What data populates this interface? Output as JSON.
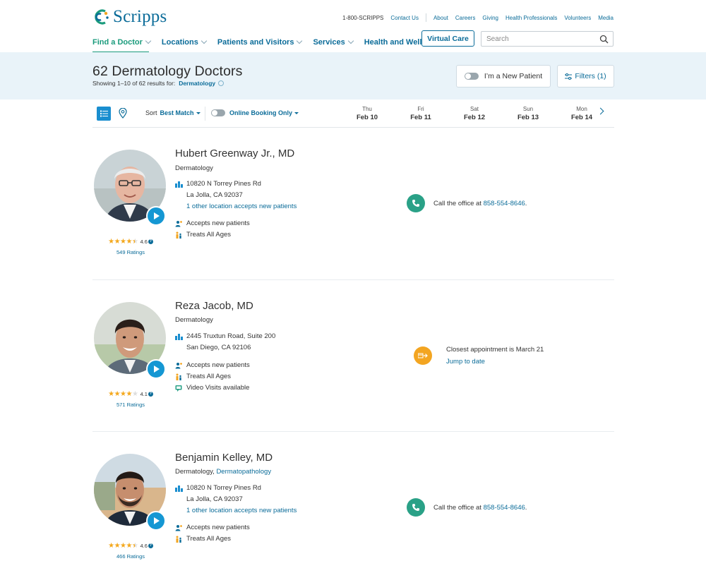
{
  "brand": {
    "name": "Scripps",
    "colors": {
      "primary": "#0b6c99",
      "green": "#1a9b7c",
      "band": "#e9f3f9",
      "star": "#f4a81d",
      "phone": "#2aa187",
      "appointment": "#f3a521"
    }
  },
  "utility_nav": {
    "phone": "1-800-SCRIPPS",
    "items": [
      "Contact Us",
      "About",
      "Careers",
      "Giving",
      "Health Professionals",
      "Volunteers",
      "Media"
    ]
  },
  "main_nav": {
    "items": [
      "Find a Doctor",
      "Locations",
      "Patients and Visitors",
      "Services",
      "Health and Wellness"
    ],
    "active": "Find a Doctor"
  },
  "virtual_care": "Virtual Care",
  "search": {
    "placeholder": "Search",
    "icon": "search-icon"
  },
  "results": {
    "title": "62 Dermatology Doctors",
    "showing": "Showing 1–10 of 62 results for:",
    "term": "Dermatology",
    "new_patient_label": "I’m a New Patient",
    "filters_label": "Filters (1)"
  },
  "toolbar": {
    "sort_label": "Sort",
    "sort_value": "Best Match",
    "online_label": "Online Booking Only",
    "days": [
      {
        "dow": "Thu",
        "date": "Feb 10"
      },
      {
        "dow": "Fri",
        "date": "Feb 11"
      },
      {
        "dow": "Sat",
        "date": "Feb 12"
      },
      {
        "dow": "Sun",
        "date": "Feb 13"
      },
      {
        "dow": "Mon",
        "date": "Feb 14"
      }
    ]
  },
  "doctors": [
    {
      "name": "Hubert Greenway Jr., MD",
      "specialty": "Dermatology",
      "address1": "10820 N Torrey Pines Rd",
      "address2": "La Jolla, CA 92037",
      "other_location": "1 other location accepts new patients",
      "attrs": [
        "Accepts new patients",
        "Treats All Ages"
      ],
      "rating": "4.6",
      "rating_stars": 4.5,
      "ratings_count": "549 Ratings",
      "call_text": "Call the office at",
      "call_number": "858-554-8646",
      "call_suffix": "."
    },
    {
      "name": "Reza Jacob, MD",
      "specialty": "Dermatology",
      "address1": "2445 Truxtun Road, Suite 200",
      "address2": "San Diego, CA 92106",
      "attrs": [
        "Accepts new patients",
        "Treats All Ages",
        "Video Visits available"
      ],
      "rating": "4.1",
      "rating_stars": 4,
      "ratings_count": "571 Ratings",
      "appt_text": "Closest appointment is March 21",
      "appt_link": "Jump to date"
    },
    {
      "name": "Benjamin Kelley, MD",
      "specialty": "Dermatology,",
      "specialty_link": "Dermatopathology",
      "address1": "10820 N Torrey Pines Rd",
      "address2": "La Jolla, CA 92037",
      "other_location": "1 other location accepts new patients",
      "attrs": [
        "Accepts new patients",
        "Treats All Ages"
      ],
      "rating": "4.6",
      "rating_stars": 4.5,
      "ratings_count": "466 Ratings",
      "call_text": "Call the office at",
      "call_number": "858-554-8646",
      "call_suffix": "."
    }
  ]
}
